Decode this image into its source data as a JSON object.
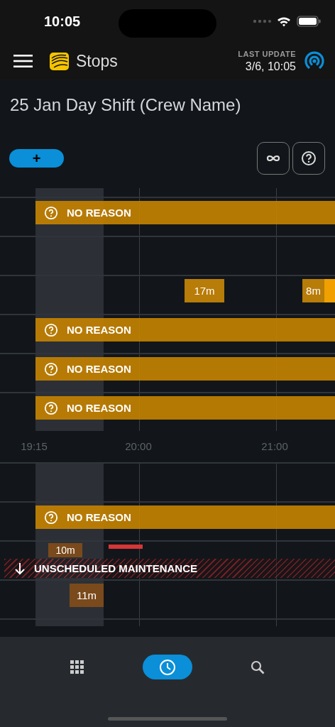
{
  "status_bar": {
    "time": "10:05"
  },
  "header": {
    "title": "Stops",
    "last_update_label": "LAST UPDATE",
    "last_update_value": "3/6, 10:05"
  },
  "shift_title": "25 Jan Day Shift (Crew Name)",
  "add_button": {
    "label": "+"
  },
  "toolbar": [
    {
      "kind": "link"
    },
    {
      "kind": "help"
    }
  ],
  "timeline": {
    "upper_rows": [
      {
        "items": [
          {
            "kind": "reason",
            "label": "NO REASON"
          }
        ]
      },
      {},
      {
        "items": [
          {
            "kind": "duration",
            "label": "17m"
          },
          {
            "kind": "duration",
            "label": "8m"
          }
        ]
      },
      {
        "items": [
          {
            "kind": "reason",
            "label": "NO REASON"
          }
        ]
      },
      {
        "items": [
          {
            "kind": "reason",
            "label": "NO REASON"
          }
        ]
      },
      {
        "items": [
          {
            "kind": "reason",
            "label": "NO REASON"
          }
        ]
      }
    ],
    "axis_labels": [
      "19:15",
      "20:00",
      "21:00"
    ],
    "lower_rows": [
      {},
      {
        "items": [
          {
            "kind": "reason",
            "label": "NO REASON"
          }
        ]
      },
      {
        "items": [
          {
            "kind": "duration",
            "label": "10m"
          },
          {
            "kind": "marker"
          },
          {
            "kind": "event",
            "label": "UNSCHEDULED MAINTENANCE"
          }
        ]
      },
      {
        "items": [
          {
            "kind": "duration",
            "label": "11m"
          }
        ]
      }
    ]
  },
  "nav": [
    {
      "kind": "apps",
      "selected": false
    },
    {
      "kind": "history",
      "selected": true
    },
    {
      "kind": "search",
      "selected": false
    }
  ]
}
